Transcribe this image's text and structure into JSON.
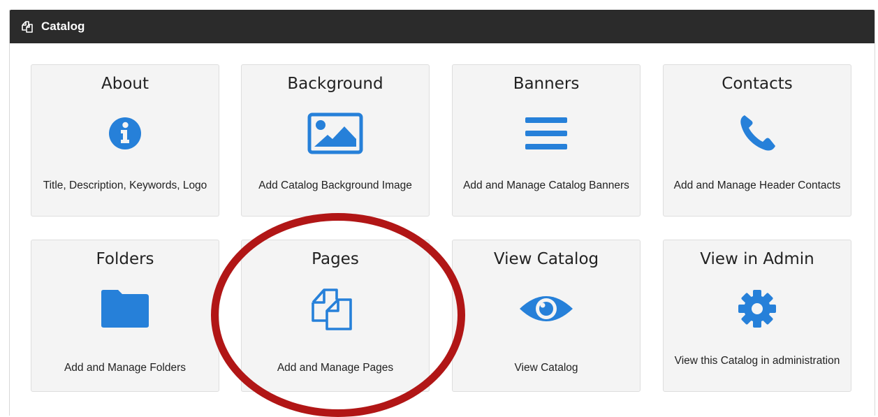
{
  "panel": {
    "title": "Catalog",
    "header_icon": "pages-icon"
  },
  "tiles": [
    {
      "title": "About",
      "desc": "Title, Description, Keywords, Logo",
      "icon": "info-icon"
    },
    {
      "title": "Background",
      "desc": "Add Catalog Background Image",
      "icon": "image-icon"
    },
    {
      "title": "Banners",
      "desc": "Add and Manage Catalog Banners",
      "icon": "menu-bars-icon"
    },
    {
      "title": "Contacts",
      "desc": "Add and Manage Header Contacts",
      "icon": "phone-icon"
    },
    {
      "title": "Folders",
      "desc": "Add and Manage Folders",
      "icon": "folder-icon"
    },
    {
      "title": "Pages",
      "desc": "Add and Manage Pages",
      "icon": "pages-icon"
    },
    {
      "title": "View Catalog",
      "desc": "View Catalog",
      "icon": "eye-icon"
    },
    {
      "title": "View in Admin",
      "desc": "View this Catalog in administration",
      "icon": "gear-icon"
    }
  ],
  "colors": {
    "accent": "#2680d9",
    "header_bg": "#2b2b2b",
    "tile_bg": "#f4f4f4",
    "highlight_circle": "#b11616"
  }
}
